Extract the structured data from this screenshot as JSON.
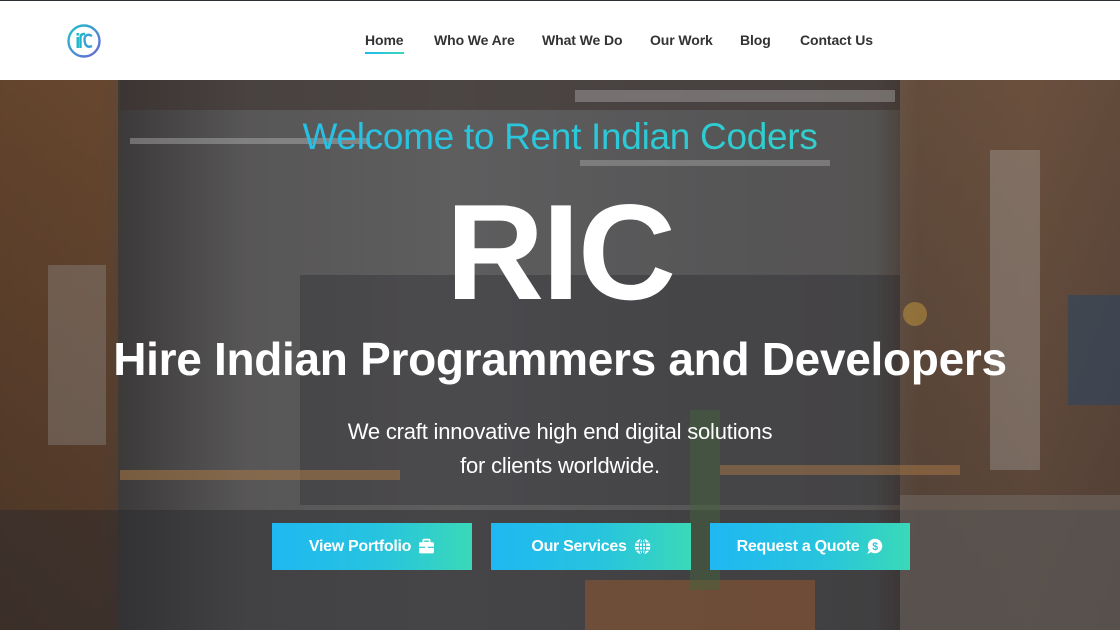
{
  "brand": {
    "logo_text": "RIC",
    "accent_start": "#20b9ef",
    "accent_end": "#3ad9b8"
  },
  "nav": {
    "items": [
      {
        "label": "Home",
        "active": true
      },
      {
        "label": "Who We Are"
      },
      {
        "label": "What We Do"
      },
      {
        "label": "Our Work"
      },
      {
        "label": "Blog"
      },
      {
        "label": "Contact Us"
      }
    ]
  },
  "hero": {
    "welcome": "Welcome to Rent Indian Coders",
    "acronym": "RIC",
    "headline": "Hire Indian Programmers and Developers",
    "tagline_line1": "We craft innovative high end digital solutions",
    "tagline_line2": "for clients worldwide."
  },
  "buttons": [
    {
      "label": "View Portfolio",
      "icon": "briefcase-icon"
    },
    {
      "label": "Our Services",
      "icon": "globe-icon"
    },
    {
      "label": "Request a Quote",
      "icon": "dollar-chat-icon"
    }
  ]
}
